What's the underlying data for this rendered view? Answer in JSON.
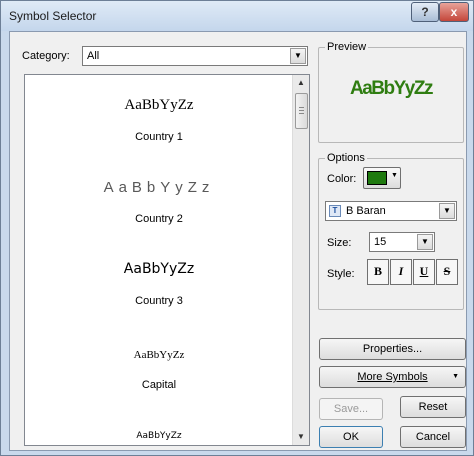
{
  "window": {
    "title": "Symbol Selector",
    "help_glyph": "?",
    "close_glyph": "x"
  },
  "category": {
    "label": "Category:",
    "value": "All"
  },
  "symbols": [
    {
      "sample": "AaBbYyZz",
      "label": "Country 1"
    },
    {
      "sample": "AaBbYyZz",
      "label": "Country 2"
    },
    {
      "sample": "AaBbYyZz",
      "label": "Country 3"
    },
    {
      "sample": "AaBbYyZz",
      "label": "Capital"
    },
    {
      "sample": "AaBbYyZz",
      "label": ""
    }
  ],
  "preview": {
    "label": "Preview",
    "sample": "AaBbYyZz",
    "color": "#2f7d11"
  },
  "options": {
    "label": "Options",
    "color_label": "Color:",
    "color_value": "#1f7a0f",
    "font": "B Baran",
    "font_icon": "font-icon",
    "size_label": "Size:",
    "size": "15",
    "style_label": "Style:",
    "style_buttons": [
      "B",
      "I",
      "U",
      "S"
    ]
  },
  "buttons": {
    "properties": "Properties...",
    "more_symbols": "More Symbols",
    "save": "Save...",
    "reset": "Reset",
    "ok": "OK",
    "cancel": "Cancel"
  }
}
